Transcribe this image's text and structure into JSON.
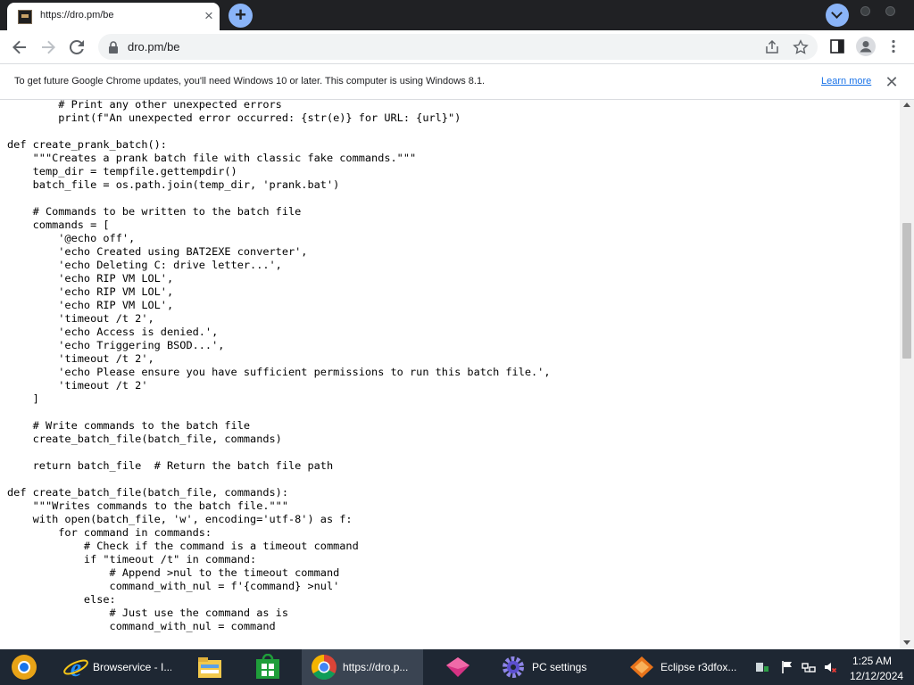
{
  "tab": {
    "title": "https://dro.pm/be"
  },
  "address_bar": {
    "url": "dro.pm/be"
  },
  "info_bar": {
    "message": "To get future Google Chrome updates, you'll need Windows 10 or later. This computer is using Windows 8.1.",
    "link": "Learn more"
  },
  "code_lines": [
    "        # Print any other unexpected errors",
    "        print(f\"An unexpected error occurred: {str(e)} for URL: {url}\")",
    "",
    "def create_prank_batch():",
    "    \"\"\"Creates a prank batch file with classic fake commands.\"\"\"",
    "    temp_dir = tempfile.gettempdir()",
    "    batch_file = os.path.join(temp_dir, 'prank.bat')",
    "",
    "    # Commands to be written to the batch file",
    "    commands = [",
    "        '@echo off',",
    "        'echo Created using BAT2EXE converter',",
    "        'echo Deleting C: drive letter...',",
    "        'echo RIP VM LOL',",
    "        'echo RIP VM LOL',",
    "        'echo RIP VM LOL',",
    "        'timeout /t 2',",
    "        'echo Access is denied.',",
    "        'echo Triggering BSOD...',",
    "        'timeout /t 2',",
    "        'echo Please ensure you have sufficient permissions to run this batch file.',",
    "        'timeout /t 2'",
    "    ]",
    "",
    "    # Write commands to the batch file",
    "    create_batch_file(batch_file, commands)",
    "",
    "    return batch_file  # Return the batch file path",
    "",
    "def create_batch_file(batch_file, commands):",
    "    \"\"\"Writes commands to the batch file.\"\"\"",
    "    with open(batch_file, 'w', encoding='utf-8') as f:",
    "        for command in commands:",
    "            # Check if the command is a timeout command",
    "            if \"timeout /t\" in command:",
    "                # Append >nul to the timeout command",
    "                command_with_nul = f'{command} >nul'",
    "            else:",
    "                # Just use the command as is",
    "                command_with_nul = command"
  ],
  "taskbar": {
    "items": [
      {
        "label": "",
        "icon": "chrome-canary-icon"
      },
      {
        "label": "Browservice - I...",
        "icon": "internet-explorer-icon"
      },
      {
        "label": "",
        "icon": "file-explorer-icon"
      },
      {
        "label": "",
        "icon": "windows-store-icon"
      },
      {
        "label": "https://dro.p...",
        "icon": "chrome-icon"
      },
      {
        "label": "",
        "icon": "app-icon"
      },
      {
        "label": "PC settings",
        "icon": "gear-icon"
      },
      {
        "label": "Eclipse r3dfox...",
        "icon": "r3dfox-icon"
      }
    ],
    "clock": {
      "time": "1:25 AM",
      "date": "12/12/2024"
    }
  },
  "colors": {
    "tabstrip": "#202124",
    "accent": "#8ab4f8",
    "link": "#1a73e8",
    "taskbar": "#1e2733"
  }
}
